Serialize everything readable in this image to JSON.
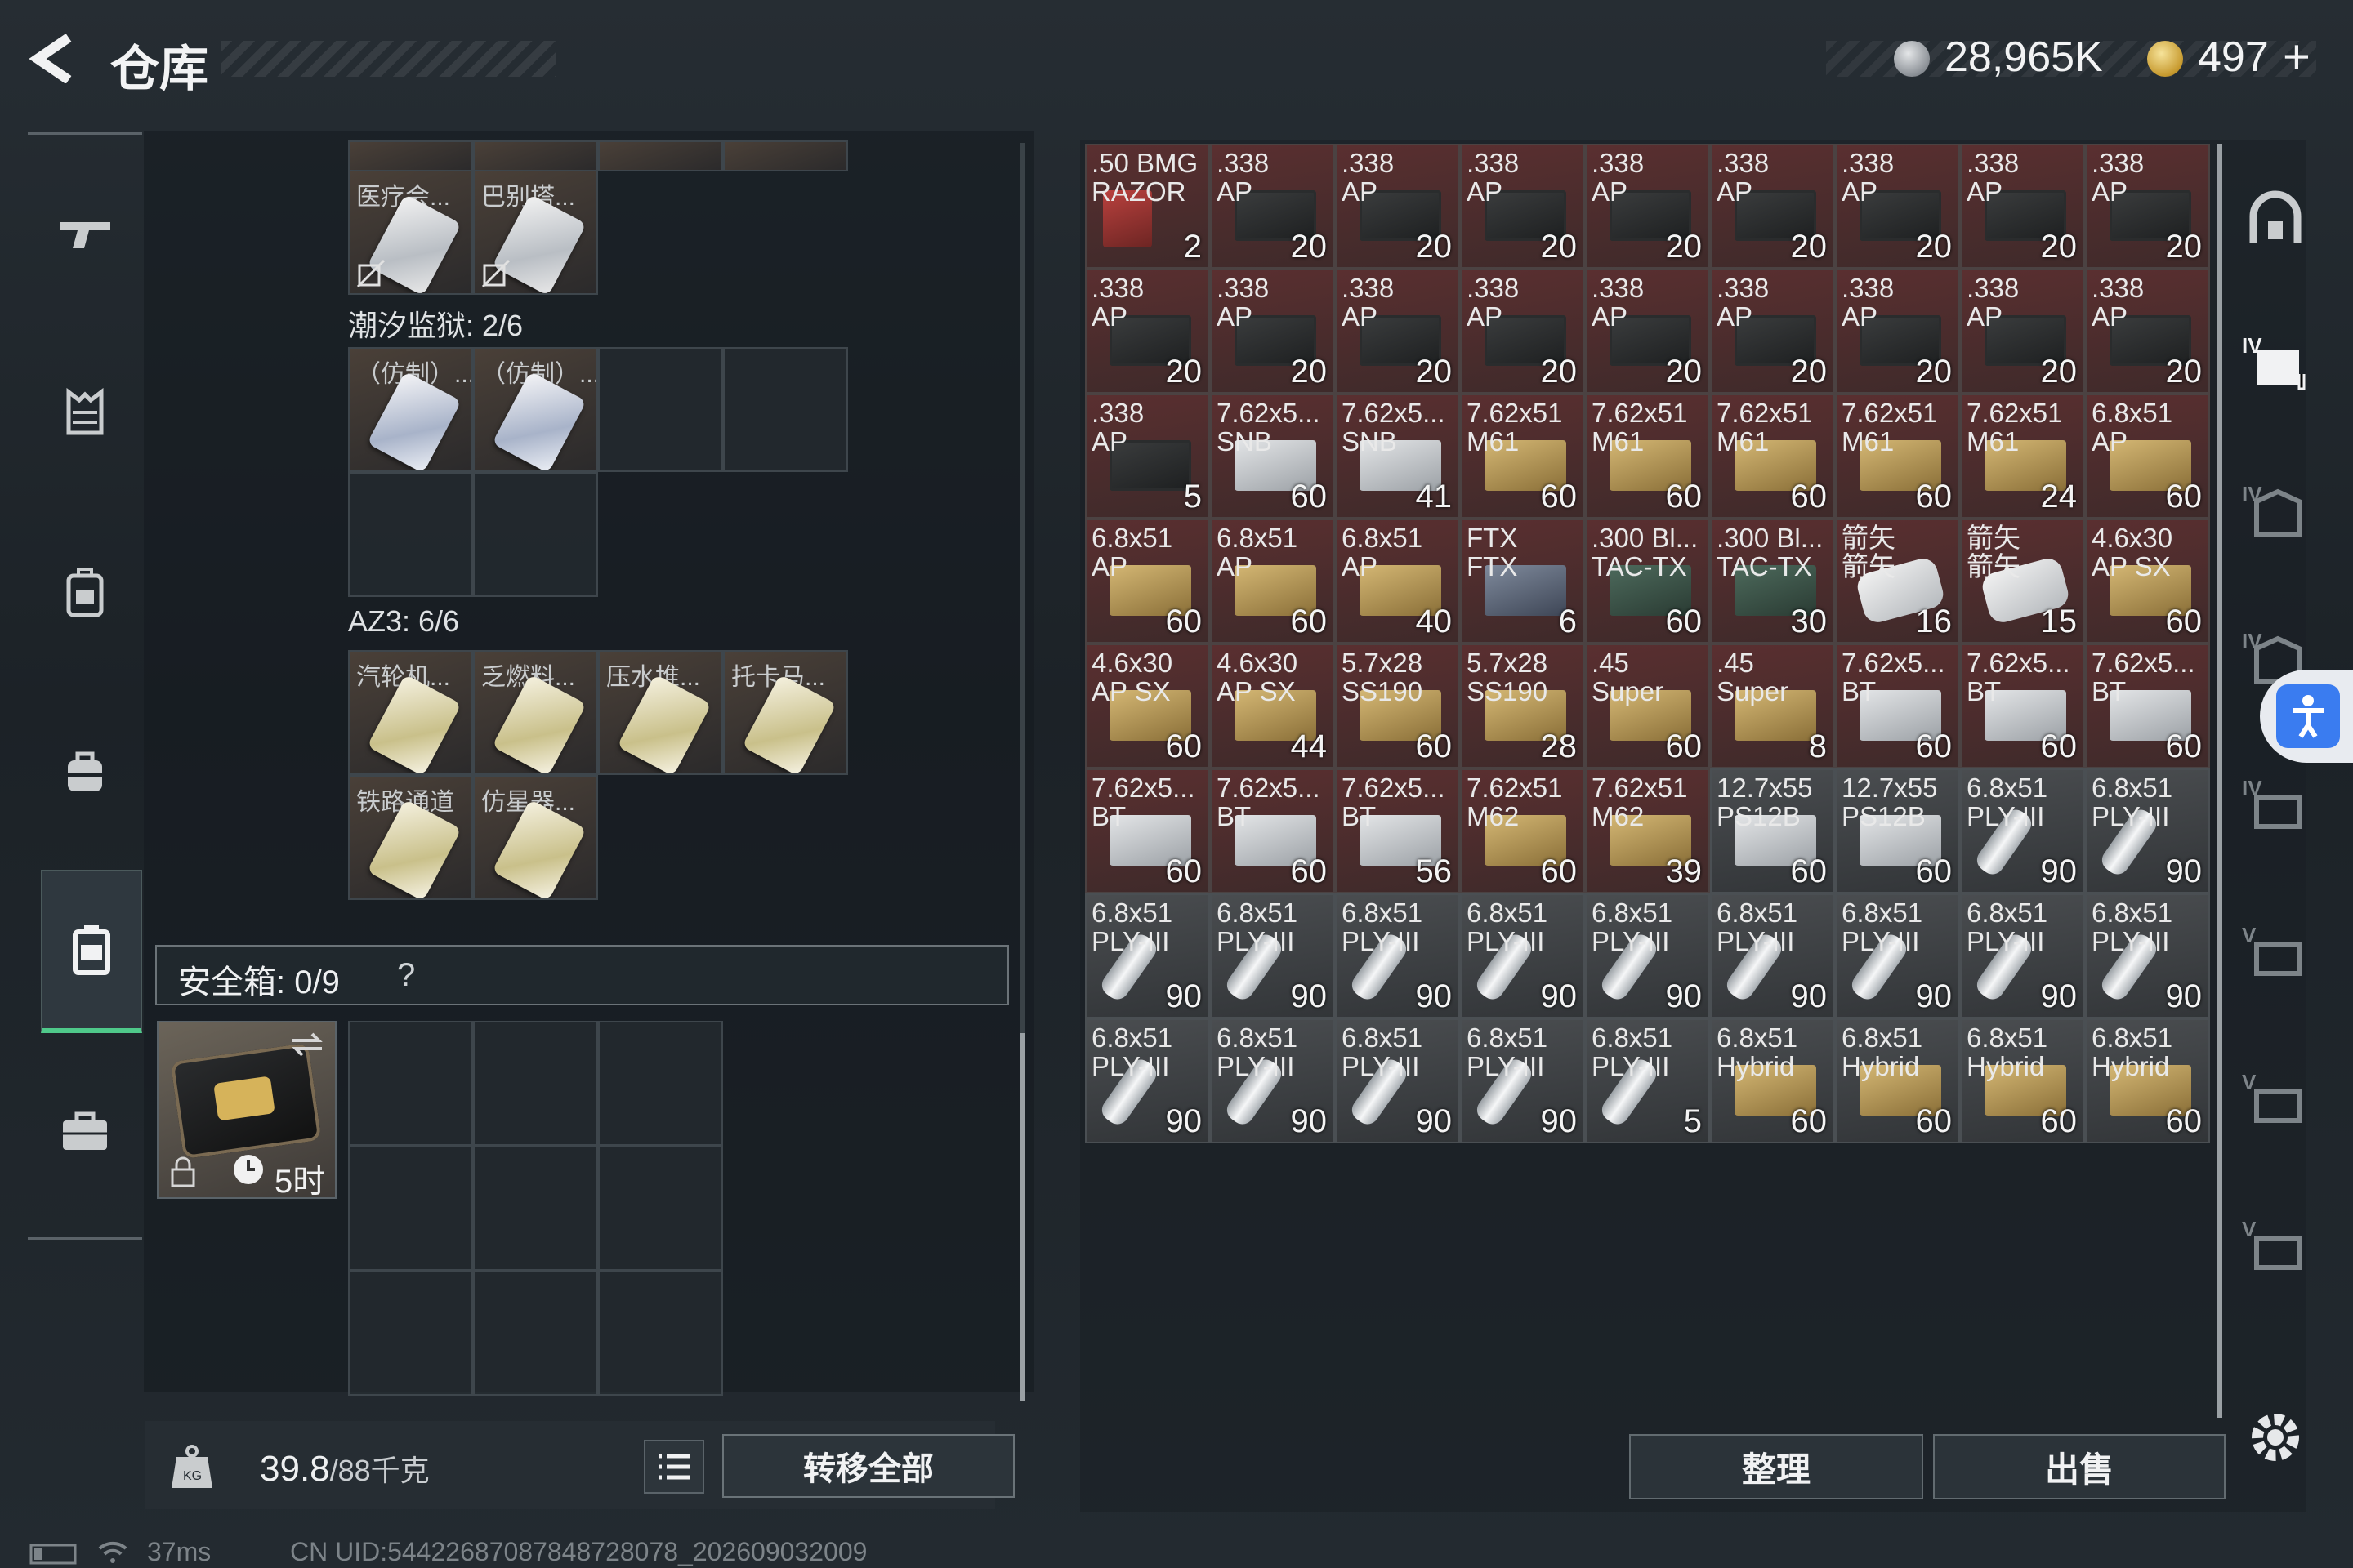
{
  "header": {
    "title": "仓库",
    "currency1": "28,965K",
    "currency2": "497",
    "plus": "+"
  },
  "nav": {
    "items": [
      "gun-icon",
      "armor-icon",
      "backpack-icon",
      "chest-rig-icon",
      "container-icon",
      "briefcase-icon"
    ],
    "active_index": 4
  },
  "left_container": {
    "partial_row_labels": [
      "",
      "",
      "",
      ""
    ],
    "top_items": [
      {
        "label": "医疗会..."
      },
      {
        "label": "巴别塔..."
      }
    ],
    "section1": {
      "label": "潮汐监狱: 2/6",
      "items": [
        {
          "label": "（仿制）..."
        },
        {
          "label": "（仿制）..."
        }
      ]
    },
    "section2": {
      "label": "AZ3: 6/6",
      "items": [
        {
          "label": "汽轮机..."
        },
        {
          "label": "乏燃料..."
        },
        {
          "label": "压水堆..."
        },
        {
          "label": "托卡马..."
        },
        {
          "label": "铁路通道"
        },
        {
          "label": "仿星器..."
        }
      ]
    },
    "safebox": {
      "label": "安全箱: 0/9",
      "help": "?",
      "timer": "5时"
    },
    "weight": {
      "value": "39.8",
      "capacity": "/88千克"
    },
    "transfer_all": "转移全部"
  },
  "stash": {
    "items": [
      {
        "n": ".50 BMG\nRAZOR",
        "q": "2",
        "bg": "red",
        "pic": "red"
      },
      {
        "n": ".338\nAP",
        "q": "20",
        "bg": "red",
        "pic": "mag"
      },
      {
        "n": ".338\nAP",
        "q": "20",
        "bg": "red",
        "pic": "mag"
      },
      {
        "n": ".338\nAP",
        "q": "20",
        "bg": "red",
        "pic": "mag"
      },
      {
        "n": ".338\nAP",
        "q": "20",
        "bg": "red",
        "pic": "mag"
      },
      {
        "n": ".338\nAP",
        "q": "20",
        "bg": "red",
        "pic": "mag"
      },
      {
        "n": ".338\nAP",
        "q": "20",
        "bg": "red",
        "pic": "mag"
      },
      {
        "n": ".338\nAP",
        "q": "20",
        "bg": "red",
        "pic": "mag"
      },
      {
        "n": ".338\nAP",
        "q": "20",
        "bg": "red",
        "pic": "mag"
      },
      {
        "n": ".338\nAP",
        "q": "20",
        "bg": "red",
        "pic": "mag"
      },
      {
        "n": ".338\nAP",
        "q": "20",
        "bg": "red",
        "pic": "mag"
      },
      {
        "n": ".338\nAP",
        "q": "20",
        "bg": "red",
        "pic": "mag"
      },
      {
        "n": ".338\nAP",
        "q": "20",
        "bg": "red",
        "pic": "mag"
      },
      {
        "n": ".338\nAP",
        "q": "20",
        "bg": "red",
        "pic": "mag"
      },
      {
        "n": ".338\nAP",
        "q": "20",
        "bg": "red",
        "pic": "mag"
      },
      {
        "n": ".338\nAP",
        "q": "20",
        "bg": "red",
        "pic": "mag"
      },
      {
        "n": ".338\nAP",
        "q": "20",
        "bg": "red",
        "pic": "mag"
      },
      {
        "n": ".338\nAP",
        "q": "20",
        "bg": "red",
        "pic": "mag"
      },
      {
        "n": ".338\nAP",
        "q": "5",
        "bg": "red",
        "pic": "mag"
      },
      {
        "n": "7.62x5...\nSNB",
        "q": "60",
        "bg": "red",
        "pic": "boxw"
      },
      {
        "n": "7.62x5...\nSNB",
        "q": "41",
        "bg": "red",
        "pic": "boxw"
      },
      {
        "n": "7.62x51\nM61",
        "q": "60",
        "bg": "red",
        "pic": "boxy"
      },
      {
        "n": "7.62x51\nM61",
        "q": "60",
        "bg": "red",
        "pic": "boxy"
      },
      {
        "n": "7.62x51\nM61",
        "q": "60",
        "bg": "red",
        "pic": "boxy"
      },
      {
        "n": "7.62x51\nM61",
        "q": "60",
        "bg": "red",
        "pic": "boxy"
      },
      {
        "n": "7.62x51\nM61",
        "q": "24",
        "bg": "red",
        "pic": "boxy"
      },
      {
        "n": "6.8x51\nAP",
        "q": "60",
        "bg": "red",
        "pic": "boxy"
      },
      {
        "n": "6.8x51\nAP",
        "q": "60",
        "bg": "red",
        "pic": "boxy"
      },
      {
        "n": "6.8x51\nAP",
        "q": "60",
        "bg": "red",
        "pic": "boxy"
      },
      {
        "n": "6.8x51\nAP",
        "q": "40",
        "bg": "red",
        "pic": "boxy"
      },
      {
        "n": "FTX\nFTX",
        "q": "6",
        "bg": "red",
        "pic": "boxb"
      },
      {
        "n": ".300 Bl...\nTAC-TX",
        "q": "60",
        "bg": "red",
        "pic": "boxg"
      },
      {
        "n": ".300 Bl...\nTAC-TX",
        "q": "30",
        "bg": "red",
        "pic": "boxg"
      },
      {
        "n": "箭矢\n箭矢",
        "q": "16",
        "bg": "red",
        "pic": "tube"
      },
      {
        "n": "箭矢\n箭矢",
        "q": "15",
        "bg": "red",
        "pic": "tube"
      },
      {
        "n": "4.6x30\nAP SX",
        "q": "60",
        "bg": "red",
        "pic": "boxy"
      },
      {
        "n": "4.6x30\nAP SX",
        "q": "60",
        "bg": "red",
        "pic": "boxy"
      },
      {
        "n": "4.6x30\nAP SX",
        "q": "44",
        "bg": "red",
        "pic": "boxy"
      },
      {
        "n": "5.7x28\nSS190",
        "q": "60",
        "bg": "red",
        "pic": "boxy"
      },
      {
        "n": "5.7x28\nSS190",
        "q": "28",
        "bg": "red",
        "pic": "boxy"
      },
      {
        "n": ".45\nSuper",
        "q": "60",
        "bg": "red",
        "pic": "boxy"
      },
      {
        "n": ".45\nSuper",
        "q": "8",
        "bg": "red",
        "pic": "boxy"
      },
      {
        "n": "7.62x5...\nBT",
        "q": "60",
        "bg": "red",
        "pic": "boxw"
      },
      {
        "n": "7.62x5...\nBT",
        "q": "60",
        "bg": "red",
        "pic": "boxw"
      },
      {
        "n": "7.62x5...\nBT",
        "q": "60",
        "bg": "red",
        "pic": "boxw"
      },
      {
        "n": "7.62x5...\nBT",
        "q": "60",
        "bg": "red",
        "pic": "boxw"
      },
      {
        "n": "7.62x5...\nBT",
        "q": "60",
        "bg": "red",
        "pic": "boxw"
      },
      {
        "n": "7.62x5...\nBT",
        "q": "56",
        "bg": "red",
        "pic": "boxw"
      },
      {
        "n": "7.62x51\nM62",
        "q": "60",
        "bg": "red",
        "pic": "boxy"
      },
      {
        "n": "7.62x51\nM62",
        "q": "39",
        "bg": "red",
        "pic": "boxy"
      },
      {
        "n": "12.7x55\nPS12B",
        "q": "60",
        "bg": "grey",
        "pic": "boxw"
      },
      {
        "n": "12.7x55\nPS12B",
        "q": "60",
        "bg": "grey",
        "pic": "boxw"
      },
      {
        "n": "6.8x51\nPLY-III",
        "q": "90",
        "bg": "grey",
        "pic": "round"
      },
      {
        "n": "6.8x51\nPLY-III",
        "q": "90",
        "bg": "grey",
        "pic": "round"
      },
      {
        "n": "6.8x51\nPLY-III",
        "q": "90",
        "bg": "grey",
        "pic": "round"
      },
      {
        "n": "6.8x51\nPLY-III",
        "q": "90",
        "bg": "grey",
        "pic": "round"
      },
      {
        "n": "6.8x51\nPLY-III",
        "q": "90",
        "bg": "grey",
        "pic": "round"
      },
      {
        "n": "6.8x51\nPLY-III",
        "q": "90",
        "bg": "grey",
        "pic": "round"
      },
      {
        "n": "6.8x51\nPLY-III",
        "q": "90",
        "bg": "grey",
        "pic": "round"
      },
      {
        "n": "6.8x51\nPLY-III",
        "q": "90",
        "bg": "grey",
        "pic": "round"
      },
      {
        "n": "6.8x51\nPLY-III",
        "q": "90",
        "bg": "grey",
        "pic": "round"
      },
      {
        "n": "6.8x51\nPLY-III",
        "q": "90",
        "bg": "grey",
        "pic": "round"
      },
      {
        "n": "6.8x51\nPLY-III",
        "q": "90",
        "bg": "grey",
        "pic": "round"
      },
      {
        "n": "6.8x51\nPLY-III",
        "q": "90",
        "bg": "grey",
        "pic": "round"
      },
      {
        "n": "6.8x51\nPLY-III",
        "q": "90",
        "bg": "grey",
        "pic": "round"
      },
      {
        "n": "6.8x51\nPLY-III",
        "q": "90",
        "bg": "grey",
        "pic": "round"
      },
      {
        "n": "6.8x51\nPLY-III",
        "q": "90",
        "bg": "grey",
        "pic": "round"
      },
      {
        "n": "6.8x51\nPLY-III",
        "q": "5",
        "bg": "grey",
        "pic": "round"
      },
      {
        "n": "6.8x51\nHybrid",
        "q": "60",
        "bg": "grey",
        "pic": "boxy"
      },
      {
        "n": "6.8x51\nHybrid",
        "q": "60",
        "bg": "grey",
        "pic": "boxy"
      },
      {
        "n": "6.8x51\nHybrid",
        "q": "60",
        "bg": "grey",
        "pic": "boxy"
      },
      {
        "n": "6.8x51\nHybrid",
        "q": "60",
        "bg": "grey",
        "pic": "boxy"
      }
    ],
    "sort": "整理",
    "sell": "出售"
  },
  "right_sidebar": {
    "items": [
      "headset-icon",
      "container-iv-icon",
      "armor-iv-icon",
      "armor-iv-icon",
      "rig-iv-icon",
      "rig-v-icon",
      "rig-v-icon",
      "rig-v-icon"
    ]
  },
  "status": {
    "ping": "37ms",
    "uid": "CN UID:5442268708784872807​8_202609032009"
  },
  "colors": {
    "accent_green": "#4fc98a",
    "item_red": "#5a2f30",
    "item_grey": "#4a4d50"
  }
}
